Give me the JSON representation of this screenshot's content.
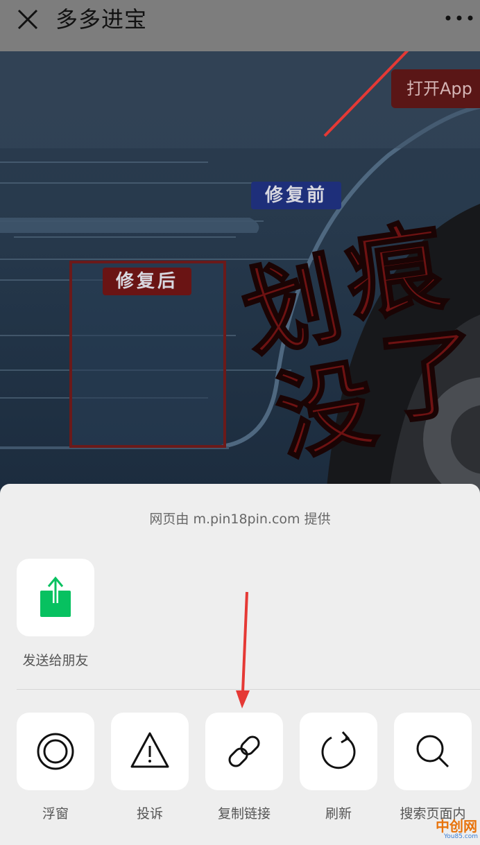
{
  "header": {
    "title": "多多进宝",
    "close_icon": "close-icon",
    "more_icon": "more-dots-icon"
  },
  "webpage": {
    "open_app_label": "打开App",
    "tag_before": "修复前",
    "tag_after": "修复后",
    "headline_chars": [
      "划",
      "痕",
      "没",
      "了"
    ]
  },
  "sheet": {
    "provider_text": "网页由 m.pin18pin.com 提供",
    "share_row": [
      {
        "label": "发送给朋友",
        "icon": "share-to-friend-icon",
        "icon_color": "#07c160"
      }
    ],
    "action_row": [
      {
        "label": "浮窗",
        "icon": "floating-window-icon"
      },
      {
        "label": "投诉",
        "icon": "warning-triangle-icon"
      },
      {
        "label": "复制链接",
        "icon": "link-icon"
      },
      {
        "label": "刷新",
        "icon": "refresh-icon"
      },
      {
        "label": "搜索页面内",
        "icon": "search-icon"
      }
    ]
  },
  "watermark": {
    "text": "中创网",
    "sub": "You85.com"
  },
  "colors": {
    "topbar": "#7d7d7d",
    "sheet_bg": "#eeeeee",
    "annotation_arrow": "#e53935",
    "accent_green": "#07c160"
  }
}
